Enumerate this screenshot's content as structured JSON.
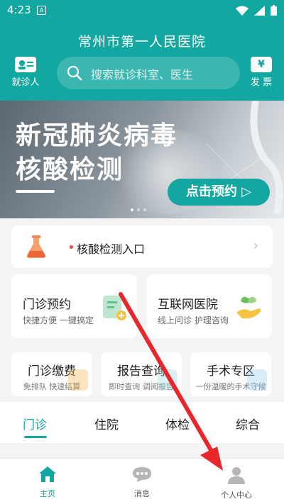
{
  "status_bar": {
    "time": "4:23",
    "sim_label": "A"
  },
  "header": {
    "title": "常州市第一人民医院",
    "left_button": {
      "label": "就诊人",
      "icon": "id-card-icon"
    },
    "search": {
      "placeholder": "搜索就诊科室、医生",
      "icon": "search-icon"
    },
    "right_button": {
      "label": "发 票",
      "icon": "invoice-icon",
      "symbol": "¥"
    }
  },
  "banner": {
    "line1": "新冠肺炎病毒",
    "line2": "核酸检测",
    "cta": "点击预约 ▷"
  },
  "entry": {
    "label": "核酸检测入口",
    "chevron": "›"
  },
  "big_cards": [
    {
      "title": "门诊预约",
      "subtitle": "快捷方便 一键搞定"
    },
    {
      "title": "互联网医院",
      "subtitle": "线上问诊 护理咨询"
    }
  ],
  "small_cards": [
    {
      "title": "门诊缴费",
      "subtitle": "免排队 快速结算"
    },
    {
      "title": "报告查询",
      "subtitle": "即时查询 调阅报告"
    },
    {
      "title": "手术专区",
      "subtitle": "一份温暖的手术守候"
    }
  ],
  "tabs": [
    "门诊",
    "住院",
    "体检",
    "综合"
  ],
  "bottom_nav": [
    {
      "label": "主页",
      "icon": "home-icon"
    },
    {
      "label": "消息",
      "icon": "message-icon"
    },
    {
      "label": "个人中心",
      "icon": "profile-icon"
    }
  ],
  "colors": {
    "brand": "#12a7a0",
    "arrow": "#e8262b"
  }
}
